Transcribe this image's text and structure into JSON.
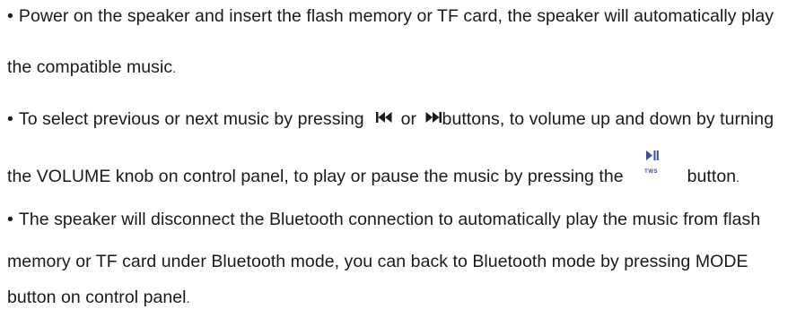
{
  "paragraphs": {
    "p1": {
      "bullet": "•",
      "line1": "Power on the speaker and insert the flash memory or TF card, the speaker will automatically play",
      "line2": "the compatible music",
      "line2_end": "."
    },
    "p2": {
      "bullet": "•",
      "line1_a": "To select previous or next music by pressing",
      "line1_or": "or",
      "line1_b": "buttons, to volume up and down by turning",
      "line2_a": "the VOLUME knob on control panel, to play or pause the music by pressing the",
      "tws_label": "TWS",
      "line2_b": "button",
      "line2_end": "."
    },
    "p3": {
      "bullet": "•",
      "line1": "The speaker will disconnect the Bluetooth connection to automatically play the music from flash",
      "line2": "memory or TF card under Bluetooth mode, you can back to Bluetooth mode by pressing MODE",
      "line3": "button on control panel",
      "line3_end": "."
    }
  },
  "icons": {
    "prev": "previous-track-icon",
    "next": "next-track-icon",
    "play_pause": "play-pause-icon",
    "icon_color": "#1a1a1a",
    "tws_color": "#3a4fa0"
  }
}
